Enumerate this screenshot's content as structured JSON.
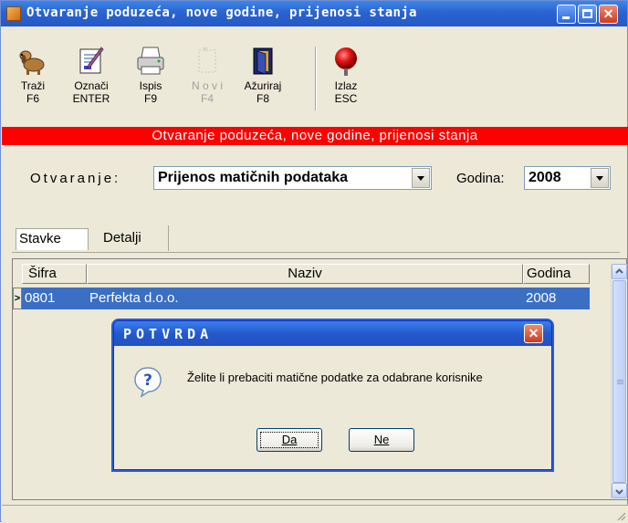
{
  "window": {
    "title": "Otvaranje poduzeća, nove godine, prijenosi stanja"
  },
  "toolbar": [
    {
      "label": "Traži",
      "key": "F6",
      "icon": "search-dog-icon",
      "enabled": true
    },
    {
      "label": "Označi",
      "key": "ENTER",
      "icon": "mark-icon",
      "enabled": true
    },
    {
      "label": "Ispis",
      "key": "F9",
      "icon": "printer-icon",
      "enabled": true
    },
    {
      "label": "N o v i",
      "key": "F4",
      "icon": "new-icon",
      "enabled": false
    },
    {
      "label": "Ažuriraj",
      "key": "F8",
      "icon": "update-icon",
      "enabled": true
    },
    {
      "label": "Izlaz",
      "key": "ESC",
      "icon": "exit-icon",
      "enabled": true
    }
  ],
  "banner": "Otvaranje poduzeća, nove godine, prijenosi stanja",
  "filters": {
    "otvaranje_label": "Otvaranje:",
    "otvaranje_value": "Prijenos matičnih podataka",
    "godina_label": "Godina:",
    "godina_value": "2008"
  },
  "tabs": [
    {
      "label": "Stavke",
      "active": true
    },
    {
      "label": "Detalji",
      "active": false
    }
  ],
  "grid": {
    "columns": [
      "Šifra",
      "Naziv",
      "Godina"
    ],
    "rows": [
      {
        "sifra": "0801",
        "naziv": "Perfekta d.o.o.",
        "godina": "2008",
        "selected": true
      }
    ]
  },
  "dialog": {
    "title": "POTVRDA",
    "message": "Želite li prebaciti matične podatke za odabrane korisnike",
    "yes_label": "Da",
    "no_label": "Ne",
    "icon": "question-icon"
  },
  "colors": {
    "banner": "#ff0000",
    "selection": "#3a6fc4",
    "titlebar": "#2a63d0"
  }
}
